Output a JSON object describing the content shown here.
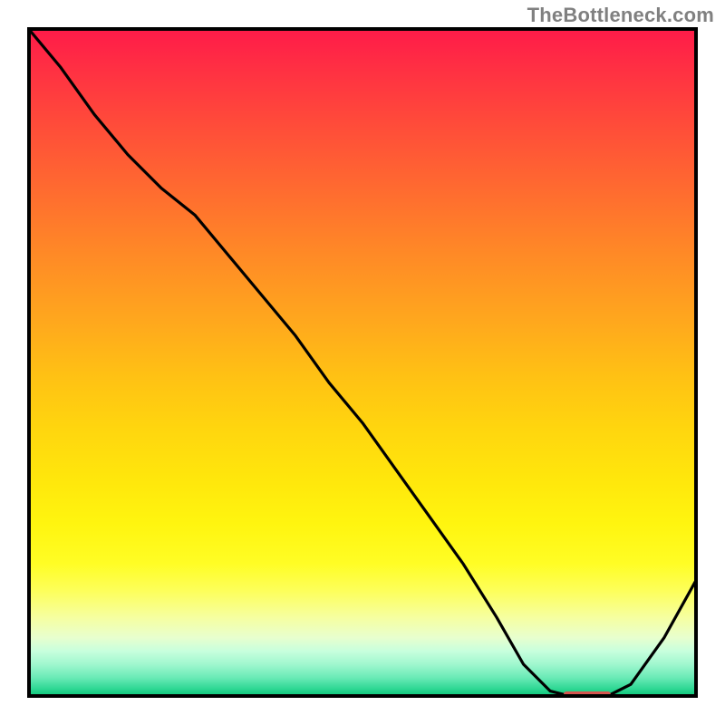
{
  "watermark": "TheBottleneck.com",
  "chart_data": {
    "type": "line",
    "title": "",
    "xlabel": "",
    "ylabel": "",
    "xlim": [
      0,
      100
    ],
    "ylim": [
      0,
      100
    ],
    "x": [
      0,
      5,
      10,
      15,
      20,
      25,
      30,
      35,
      40,
      45,
      50,
      55,
      60,
      65,
      70,
      74,
      78,
      82,
      86,
      90,
      95,
      100
    ],
    "values": [
      100,
      94,
      87,
      81,
      76,
      72,
      66,
      60,
      54,
      47,
      41,
      34,
      27,
      20,
      12,
      5,
      1,
      0,
      0,
      2,
      9,
      18
    ],
    "series": [
      {
        "name": "bottleneck-curve",
        "x": [
          0,
          5,
          10,
          15,
          20,
          25,
          30,
          35,
          40,
          45,
          50,
          55,
          60,
          65,
          70,
          74,
          78,
          82,
          86,
          90,
          95,
          100
        ],
        "values": [
          100,
          94,
          87,
          81,
          76,
          72,
          66,
          60,
          54,
          47,
          41,
          34,
          27,
          20,
          12,
          5,
          1,
          0,
          0,
          2,
          9,
          18
        ]
      }
    ],
    "marker": {
      "shape": "pill",
      "color": "#d6554e",
      "x_range": [
        80,
        87
      ],
      "y": 0
    },
    "background_gradient_stops": [
      {
        "pos": 0.0,
        "color": "#ff1a49"
      },
      {
        "pos": 0.5,
        "color": "#ffc114"
      },
      {
        "pos": 0.8,
        "color": "#fffd25"
      },
      {
        "pos": 0.95,
        "color": "#a0f7cf"
      },
      {
        "pos": 1.0,
        "color": "#07bf6e"
      }
    ]
  }
}
